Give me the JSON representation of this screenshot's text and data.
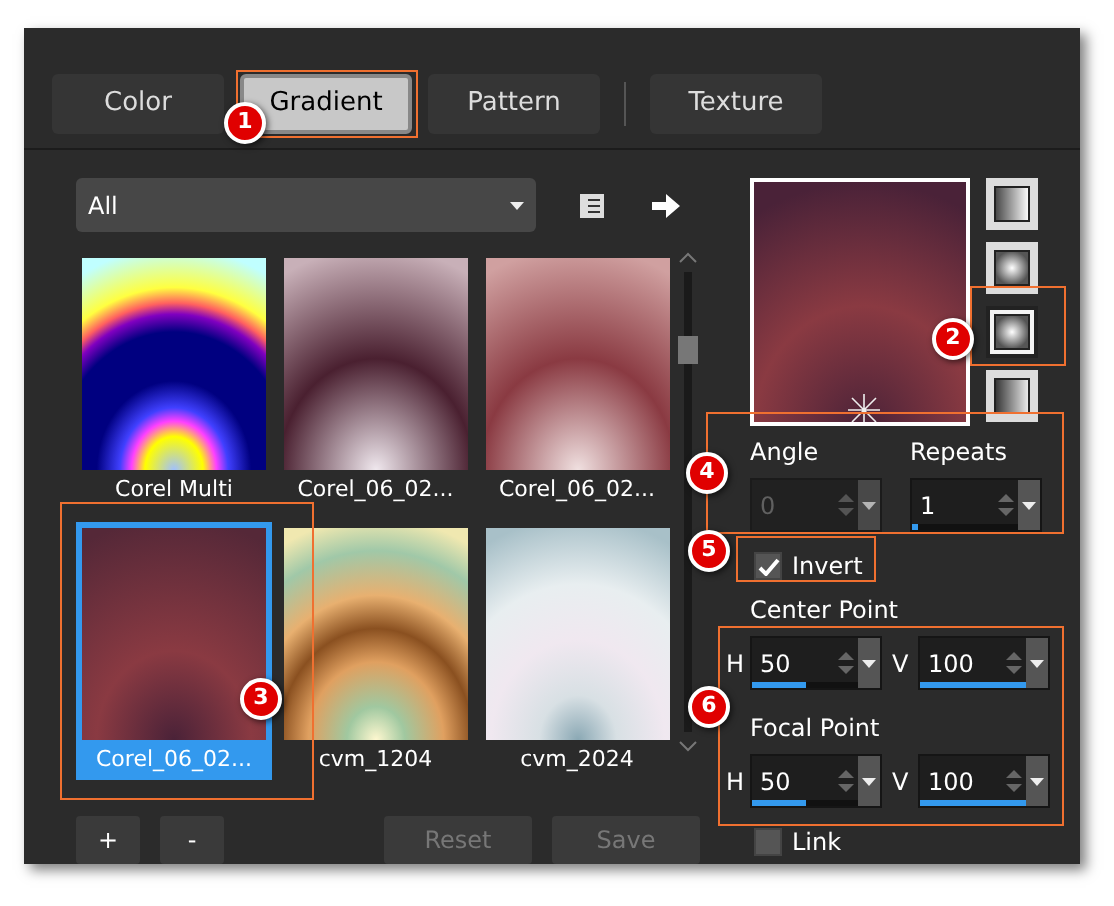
{
  "tabs": [
    {
      "label": "Color",
      "selected": false
    },
    {
      "label": "Gradient",
      "selected": true
    },
    {
      "label": "Pattern",
      "selected": false
    },
    {
      "label": "Texture",
      "selected": false
    }
  ],
  "category_dropdown": {
    "value": "All"
  },
  "gallery": [
    {
      "label": "Corel Multi",
      "selected": false
    },
    {
      "label": "Corel_06_02...",
      "selected": false
    },
    {
      "label": "Corel_06_02...",
      "selected": false
    },
    {
      "label": "Corel_06_02...",
      "selected": true
    },
    {
      "label": "cvm_1204",
      "selected": false
    },
    {
      "label": "cvm_2024",
      "selected": false
    }
  ],
  "buttons": [
    {
      "label": "+",
      "disabled": false
    },
    {
      "label": "-",
      "disabled": false
    },
    {
      "label": "Reset",
      "disabled": true
    },
    {
      "label": "Save",
      "disabled": true
    }
  ],
  "gradient_styles": [
    {
      "kind": "linear",
      "selected": false
    },
    {
      "kind": "rectangular",
      "selected": false
    },
    {
      "kind": "radial",
      "selected": true
    },
    {
      "kind": "angular",
      "selected": false
    }
  ],
  "angle": {
    "label": "Angle",
    "value": "0",
    "disabled": true
  },
  "repeats": {
    "label": "Repeats",
    "value": "1",
    "disabled": false,
    "level": 0.05
  },
  "invert": {
    "label": "Invert",
    "checked": true
  },
  "center_point": {
    "label": "Center Point",
    "h_label": "H",
    "h": {
      "value": "50",
      "level": 0.5
    },
    "v_label": "V",
    "v": {
      "value": "100"
    }
  },
  "focal_point": {
    "label": "Focal Point",
    "h_label": "H",
    "h": {
      "value": "50",
      "level": 0.5
    },
    "v_label": "V",
    "v": {
      "value": "100"
    }
  },
  "link": {
    "label": "Link",
    "checked": false
  },
  "callouts": [
    "1",
    "2",
    "3",
    "4",
    "5",
    "6"
  ]
}
